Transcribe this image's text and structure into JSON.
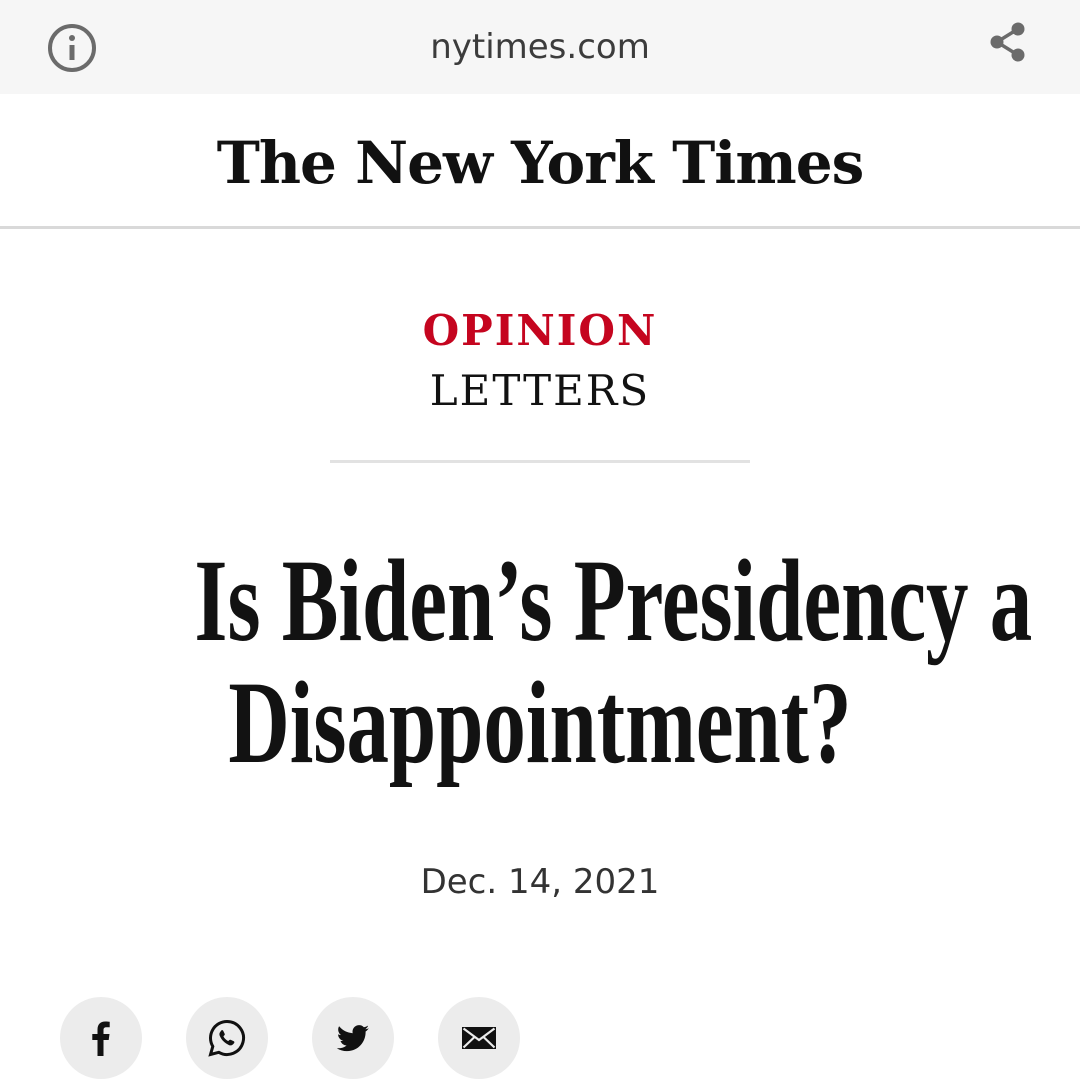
{
  "browser": {
    "url": "nytimes.com",
    "icons": {
      "info": "info-icon",
      "share": "share-icon"
    }
  },
  "masthead": {
    "logo_text": "The New York Times"
  },
  "article": {
    "section": "OPINION",
    "subsection": "LETTERS",
    "headline_line1": "Is Biden’s Presidency a",
    "headline_line2": "Disappointment?",
    "date": "Dec. 14, 2021",
    "section_color": "#c5051f"
  },
  "share_buttons": [
    {
      "icon": "facebook-icon"
    },
    {
      "icon": "whatsapp-icon"
    },
    {
      "icon": "twitter-icon"
    },
    {
      "icon": "email-icon"
    }
  ]
}
